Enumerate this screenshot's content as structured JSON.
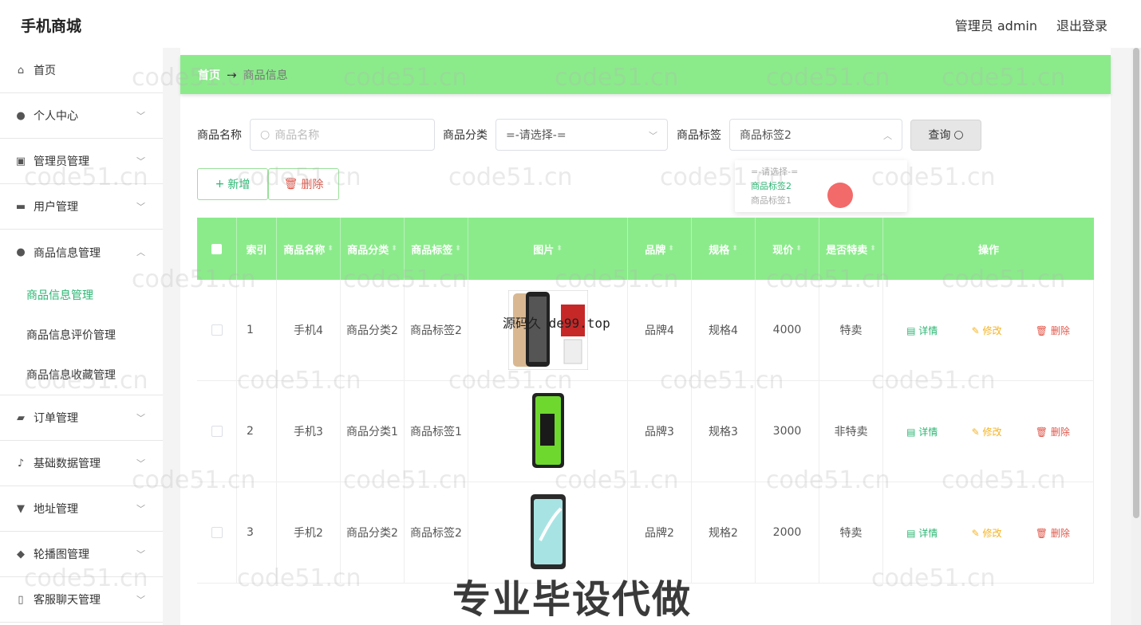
{
  "header": {
    "brand": "手机商城",
    "admin": "管理员 admin",
    "logout": "退出登录"
  },
  "sidebar": {
    "items": [
      {
        "label": "首页",
        "icon": "home-icon"
      },
      {
        "label": "个人中心",
        "icon": "user-icon"
      },
      {
        "label": "管理员管理",
        "icon": "admin-icon"
      },
      {
        "label": "用户管理",
        "icon": "briefcase-icon"
      },
      {
        "label": "商品信息管理",
        "icon": "user-icon"
      },
      {
        "label": "订单管理",
        "icon": "ticket-icon"
      },
      {
        "label": "基础数据管理",
        "icon": "mic-icon"
      },
      {
        "label": "地址管理",
        "icon": "tool-icon"
      },
      {
        "label": "轮播图管理",
        "icon": "bulb-icon"
      },
      {
        "label": "客服聊天管理",
        "icon": "phone-icon"
      }
    ],
    "sub_items": [
      "商品信息管理",
      "商品信息评价管理",
      "商品信息收藏管理"
    ]
  },
  "breadcrumb": {
    "home": "首页",
    "arrow": "→",
    "current": "商品信息"
  },
  "search": {
    "name_label": "商品名称",
    "name_placeholder": "商品名称",
    "category_label": "商品分类",
    "category_value": "=-请选择-=",
    "tag_label": "商品标签",
    "tag_value": "商品标签2",
    "query_label": "查询"
  },
  "dropdown": {
    "options": [
      "=-请选择-=",
      "商品标签2",
      "商品标签1"
    ]
  },
  "actions": {
    "add": "新增",
    "delete": "删除"
  },
  "table": {
    "headers": [
      "索引",
      "商品名称",
      "商品分类",
      "商品标签",
      "图片",
      "品牌",
      "规格",
      "现价",
      "是否特卖",
      "操作"
    ],
    "rows": [
      {
        "index": "1",
        "name": "手机4",
        "category": "商品分类2",
        "tag": "商品标签2",
        "brand": "品牌4",
        "spec": "规格4",
        "price": "4000",
        "special": "特卖"
      },
      {
        "index": "2",
        "name": "手机3",
        "category": "商品分类1",
        "tag": "商品标签1",
        "brand": "品牌3",
        "spec": "规格3",
        "price": "3000",
        "special": "非特卖"
      },
      {
        "index": "3",
        "name": "手机2",
        "category": "商品分类2",
        "tag": "商品标签2",
        "brand": "品牌2",
        "spec": "规格2",
        "price": "2000",
        "special": "特卖"
      }
    ],
    "row_actions": {
      "detail": "详情",
      "edit": "修改",
      "delete": "删除"
    }
  },
  "watermark": "code51.cn",
  "overlay": "源码久 de99.top",
  "promo": "专业毕设代做",
  "colors": {
    "accent": "#8beb8b",
    "green": "#2bb673",
    "yellow": "#f5b324",
    "red": "#e0574a"
  }
}
